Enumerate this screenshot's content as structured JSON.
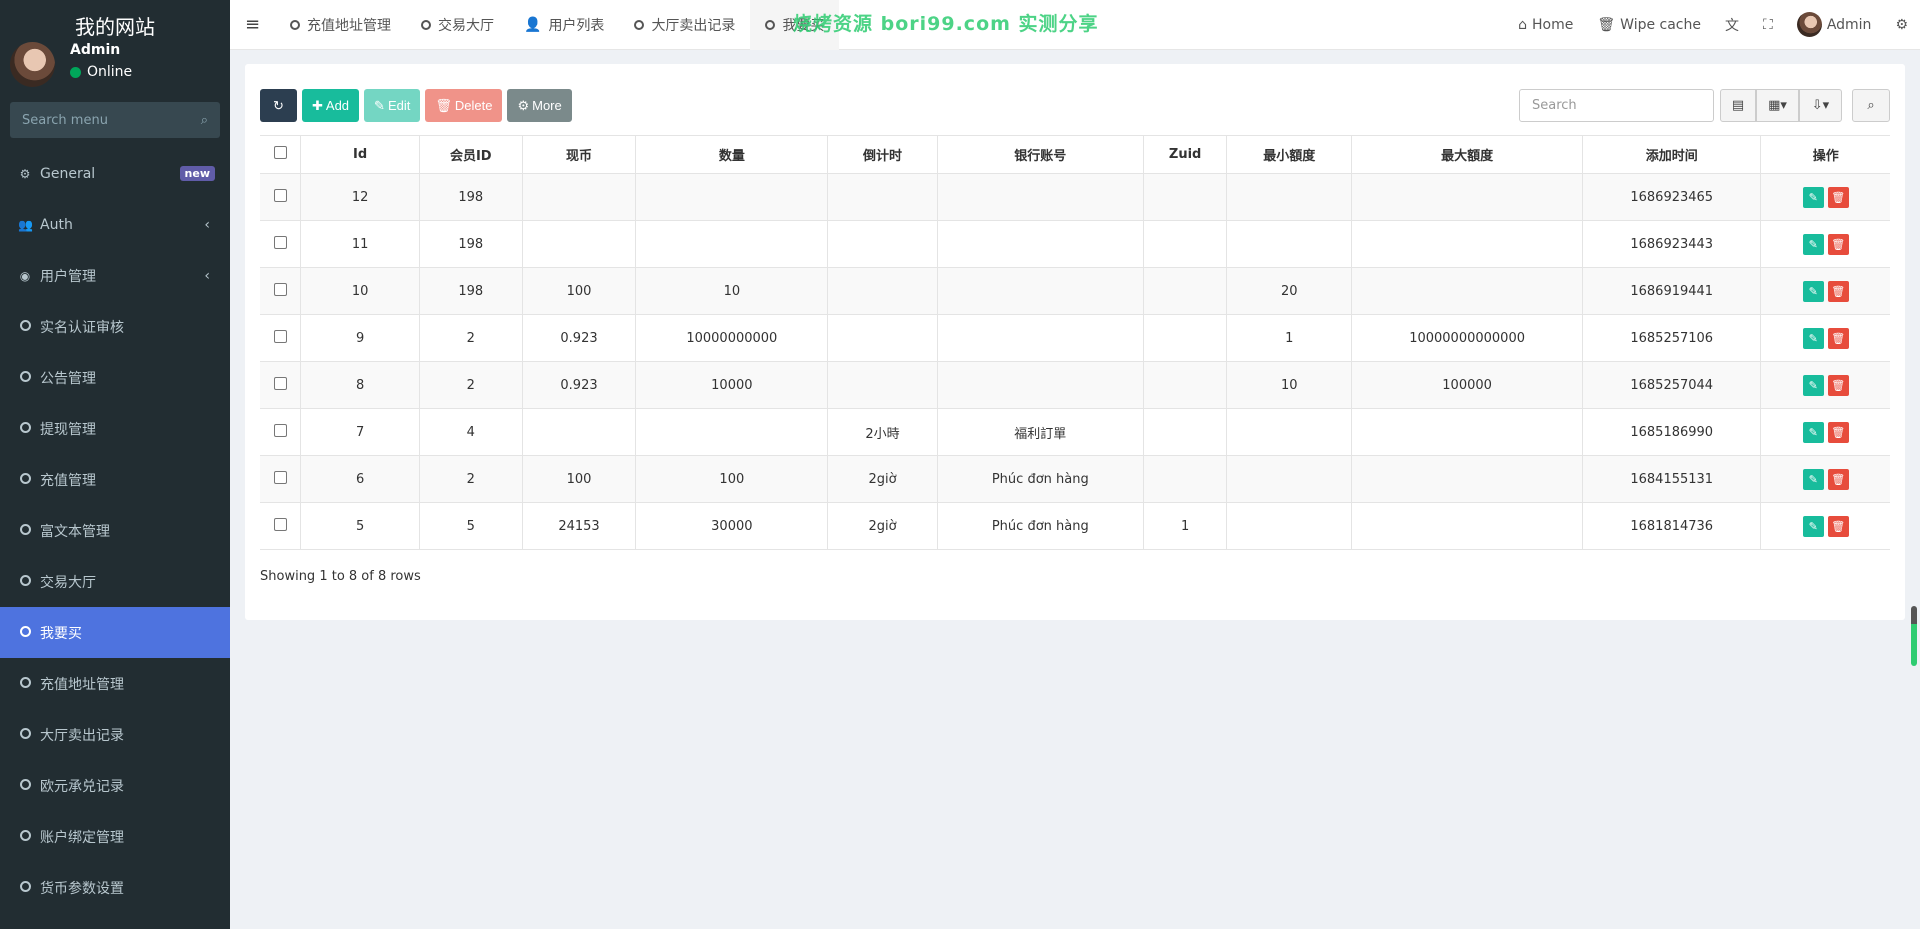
{
  "sidebar": {
    "brand": "我的网站",
    "user_name": "Admin",
    "user_status": "Online",
    "search_placeholder": "Search menu",
    "items": [
      {
        "label": "General",
        "badge": "new"
      },
      {
        "label": "Auth"
      },
      {
        "label": "用户管理"
      },
      {
        "label": "实名认证审核"
      },
      {
        "label": "公告管理"
      },
      {
        "label": "提现管理"
      },
      {
        "label": "充值管理"
      },
      {
        "label": "富文本管理"
      },
      {
        "label": "交易大厅"
      },
      {
        "label": "我要买"
      },
      {
        "label": "充值地址管理"
      },
      {
        "label": "大厅卖出记录"
      },
      {
        "label": "欧元承兑记录"
      },
      {
        "label": "账户绑定管理"
      },
      {
        "label": "货币参数设置"
      }
    ]
  },
  "topbar": {
    "tabs": [
      "充值地址管理",
      "交易大厅",
      "用户列表",
      "大厅卖出记录",
      "我要买"
    ],
    "watermark": "烧烤资源 bori99.com 实测分享",
    "home": "Home",
    "wipe_cache": "Wipe cache",
    "admin": "Admin"
  },
  "toolbar": {
    "add": "Add",
    "edit": "Edit",
    "delete": "Delete",
    "more": "More",
    "search_placeholder": "Search"
  },
  "table": {
    "columns": [
      "Id",
      "会员ID",
      "现币",
      "数量",
      "倒计时",
      "银行账号",
      "Zuid",
      "最小額度",
      "最大額度",
      "添加时间",
      "操作"
    ],
    "rows": [
      [
        "12",
        "198",
        "",
        "",
        "",
        "",
        "",
        "",
        "",
        "1686923465"
      ],
      [
        "11",
        "198",
        "",
        "",
        "",
        "",
        "",
        "",
        "",
        "1686923443"
      ],
      [
        "10",
        "198",
        "100",
        "10",
        "",
        "",
        "",
        "20",
        "",
        "1686919441"
      ],
      [
        "9",
        "2",
        "0.923",
        "10000000000",
        "",
        "",
        "",
        "1",
        "10000000000000",
        "1685257106"
      ],
      [
        "8",
        "2",
        "0.923",
        "10000",
        "",
        "",
        "",
        "10",
        "100000",
        "1685257044"
      ],
      [
        "7",
        "4",
        "",
        "",
        "2小時",
        "福利訂單",
        "",
        "",
        "",
        "1685186990"
      ],
      [
        "6",
        "2",
        "100",
        "100",
        "2giờ",
        "Phúc đơn hàng",
        "",
        "",
        "",
        "1684155131"
      ],
      [
        "5",
        "5",
        "24153",
        "30000",
        "2giờ",
        "Phúc đơn hàng",
        "1",
        "",
        "",
        "1681814736"
      ]
    ]
  },
  "footer": "Showing 1 to 8 of 8 rows"
}
